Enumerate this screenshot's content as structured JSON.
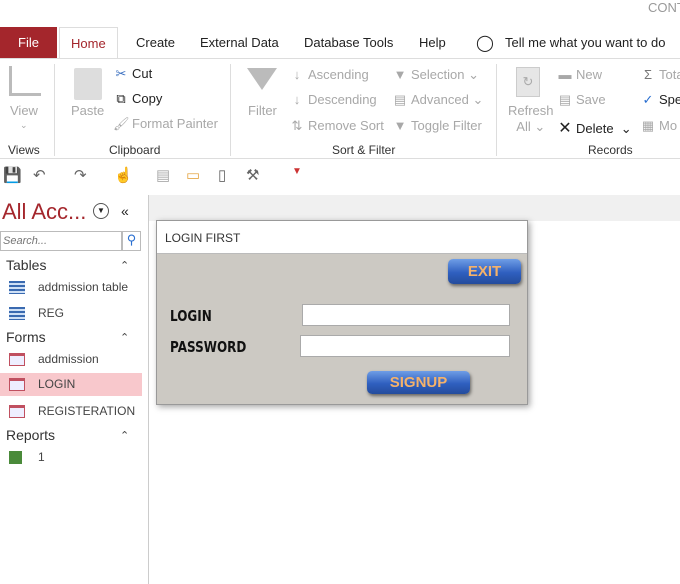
{
  "title_fragment": "CONT",
  "tabs": [
    "File",
    "Home",
    "Create",
    "External Data",
    "Database Tools",
    "Help"
  ],
  "tell_me": "Tell me what you want to do",
  "ribbon": {
    "views": {
      "view": "View",
      "group": "Views"
    },
    "clipboard": {
      "paste": "Paste",
      "cut": "Cut",
      "copy": "Copy",
      "format_painter": "Format Painter",
      "group": "Clipboard"
    },
    "sort_filter": {
      "filter": "Filter",
      "ascending": "Ascending",
      "descending": "Descending",
      "remove_sort": "Remove Sort",
      "selection": "Selection",
      "advanced": "Advanced",
      "toggle_filter": "Toggle Filter",
      "group": "Sort & Filter"
    },
    "records": {
      "refresh": "Refresh",
      "all": "All",
      "new": "New",
      "save": "Save",
      "delete": "Delete",
      "totals": "Tota",
      "spelling": "Spe",
      "more": "Mo",
      "group": "Records"
    }
  },
  "nav": {
    "title": "All Acc...",
    "search_placeholder": "Search...",
    "sections": [
      {
        "name": "Tables",
        "items": [
          "addmission table",
          "REG"
        ]
      },
      {
        "name": "Forms",
        "items": [
          "addmission",
          "LOGIN",
          "REGISTERATION"
        ]
      },
      {
        "name": "Reports",
        "items": [
          "1"
        ]
      }
    ]
  },
  "form": {
    "title": "LOGIN FIRST",
    "exit": "EXIT",
    "login_label": "LOGIN",
    "password_label": "PASSWORD",
    "login_value": "",
    "password_value": "",
    "signup": "SIGNUP"
  },
  "colors": {
    "file_tab": "#a4262c",
    "accent": "#a4262c",
    "selected_nav": "#f8c8cc",
    "form_bg": "#ccc9c3"
  }
}
